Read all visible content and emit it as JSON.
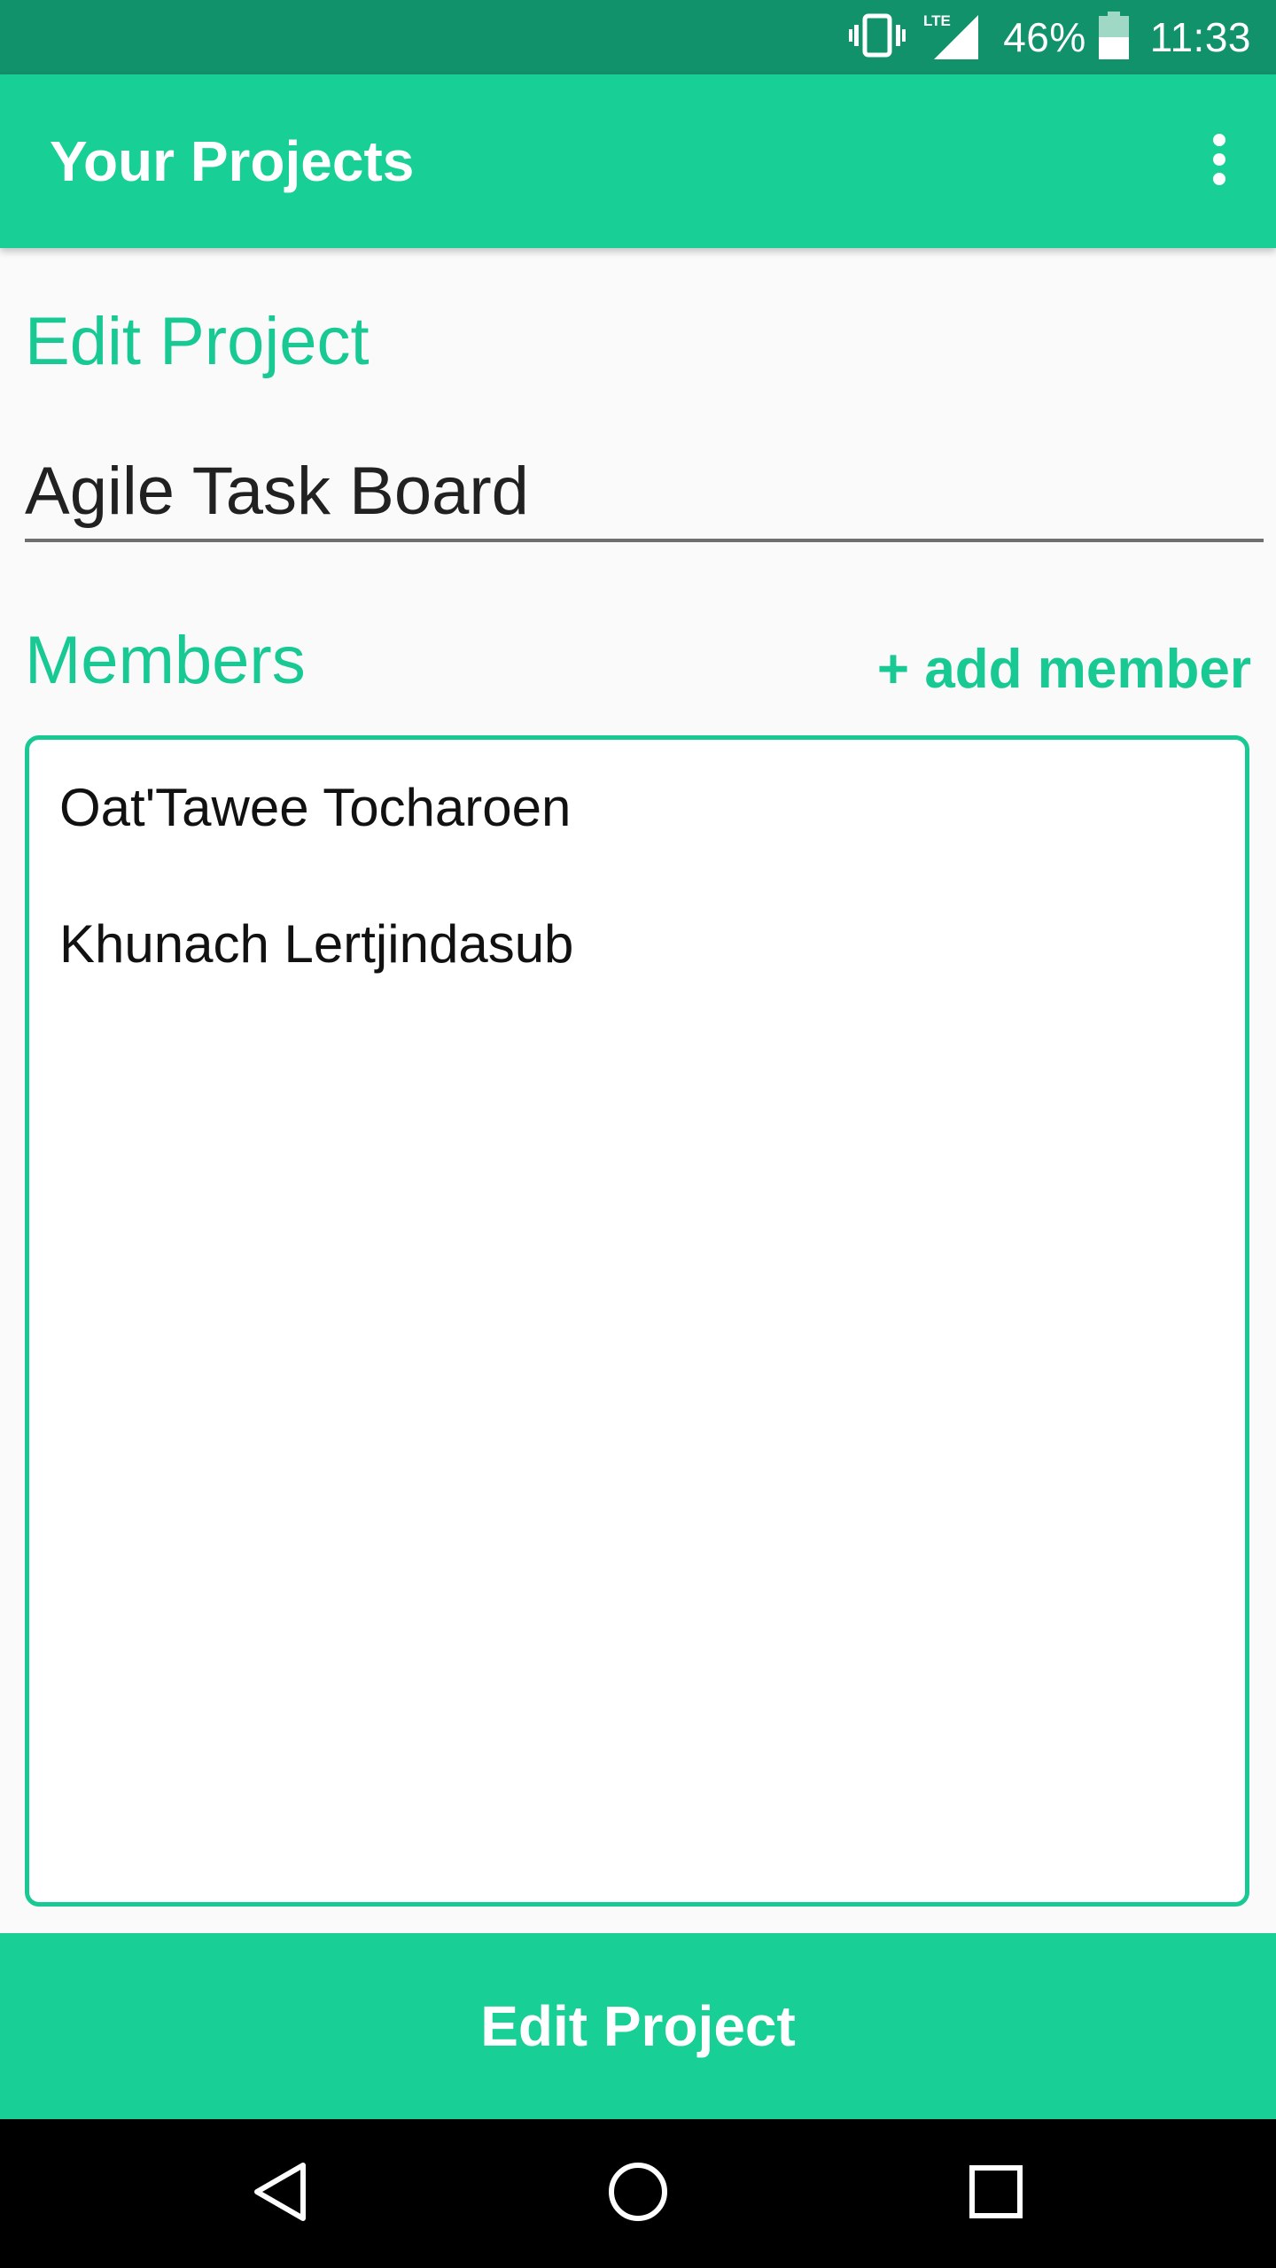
{
  "status_bar": {
    "network": "LTE",
    "battery": "46%",
    "time": "11:33",
    "icons": [
      "vibrate-icon",
      "lte-signal-icon",
      "battery-icon"
    ]
  },
  "app_bar": {
    "title": "Your Projects",
    "menu_icon": "more-vert-icon"
  },
  "form": {
    "heading": "Edit Project",
    "project_name": "Agile Task Board",
    "members_heading": "Members",
    "add_member_label": "+ add member",
    "members": [
      "Oat'Tawee Tocharoen",
      "Khunach Lertjindasub"
    ]
  },
  "submit_label": "Edit Project",
  "nav_bar": {
    "icons": [
      "back-icon",
      "home-icon",
      "recents-icon"
    ]
  },
  "colors": {
    "status_bar": "#11926a",
    "primary": "#18cf95",
    "accent_text": "#18c994",
    "background": "#fafafa",
    "nav_bar": "#000000"
  }
}
